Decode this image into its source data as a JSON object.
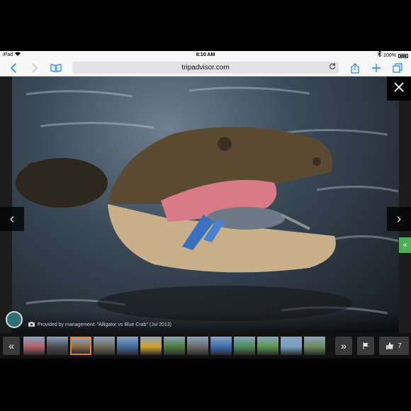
{
  "status_bar": {
    "device": "iPad",
    "time": "8:10 AM",
    "battery": "100%",
    "wifi_icon": "wifi-icon",
    "bluetooth_icon": "bluetooth-icon"
  },
  "browser": {
    "url": "tripadvisor.com",
    "buttons": [
      "back-icon",
      "forward-icon",
      "bookmarks-icon",
      "share-icon",
      "new-tab-icon",
      "tabs-icon"
    ]
  },
  "viewer": {
    "caption": "Provided by management: \"Alligator vs Blue Crab\" (Jul 2013)",
    "prev_icon": "‹",
    "next_icon": "›",
    "side_tab_icon": "«",
    "close_icon": "close-icon"
  },
  "filmstrip": {
    "prev_label": "«",
    "next_label": "»",
    "like_count": "7",
    "thumbnail_colors": [
      "#b0606a",
      "#4a4a52",
      "#8a6a4a",
      "#6a6a5a",
      "#3f6a9a",
      "#d0a030",
      "#4a7a3a",
      "#6a6a6a",
      "#3a6ab0",
      "#4a8a5a",
      "#5a9a4a",
      "#7aa0c0",
      "#6a8a5a"
    ],
    "selected_index": 2
  }
}
